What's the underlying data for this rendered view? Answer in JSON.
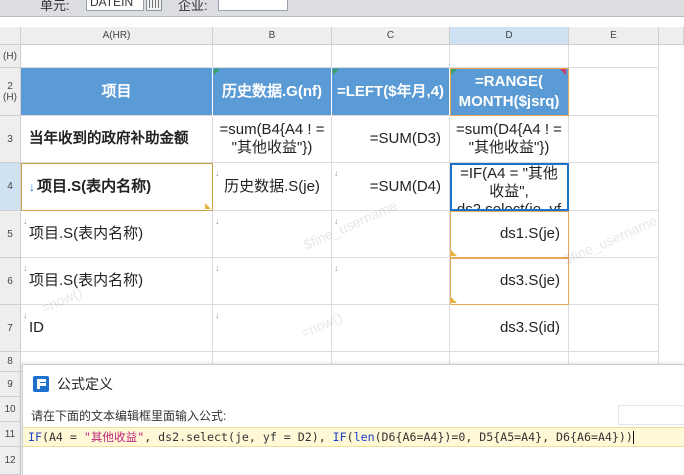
{
  "toolbar": {
    "label1": "单元:",
    "field1_value": "DATEIN",
    "label2": "企业:",
    "field2_value": ""
  },
  "grid": {
    "corner": "",
    "columns": [
      {
        "id": "A",
        "label": "A(HR)"
      },
      {
        "id": "B",
        "label": "B"
      },
      {
        "id": "C",
        "label": "C"
      },
      {
        "id": "D",
        "label": "D"
      },
      {
        "id": "E",
        "label": "E"
      }
    ],
    "rows": [
      {
        "label": "(H)"
      },
      {
        "label": "2 (H)"
      },
      {
        "label": "3"
      },
      {
        "label": "4"
      },
      {
        "label": "5"
      },
      {
        "label": "6"
      },
      {
        "label": "7"
      },
      {
        "label": "8"
      },
      {
        "label": "9"
      },
      {
        "label": "10"
      },
      {
        "label": "11"
      },
      {
        "label": "12"
      }
    ],
    "header_row": {
      "a": "项目",
      "b": "历史数据.G(nf)",
      "c": "=LEFT($年月,4)",
      "d": "=RANGE( MONTH($jsrq)"
    },
    "row3": {
      "a": "当年收到的政府补助金额",
      "b": "=sum(B4{A4 ! = \"其他收益\"})",
      "c": "=SUM(D3)",
      "d": "=sum(D4{A4 ! = \"其他收益\"})"
    },
    "row4": {
      "a": "项目.S(表内名称)",
      "b": "历史数据.S(je)",
      "c": "=SUM(D4)",
      "d": "=IF(A4 = \"其他收益\", ds2.select(je, yf"
    },
    "row5": {
      "a": "项目.S(表内名称)",
      "d": "ds1.S(je)"
    },
    "row6": {
      "a": "项目.S(表内名称)",
      "d": "ds3.S(je)"
    },
    "row7": {
      "a": "ID",
      "d": "ds3.S(id)"
    },
    "watermarks": [
      "$fine_username",
      "=now()",
      "$fine_username",
      "=now()"
    ]
  },
  "dialog": {
    "title": "公式定义",
    "prompt": "请在下面的文本编辑框里面输入公式:",
    "formula_tokens": [
      {
        "t": "IF",
        "k": "kw"
      },
      {
        "t": "(A4 = ",
        "k": "txt"
      },
      {
        "t": "\"其他收益\"",
        "k": "str"
      },
      {
        "t": ", ds2.select(je, yf = D2), ",
        "k": "txt"
      },
      {
        "t": "IF",
        "k": "kw"
      },
      {
        "t": "(",
        "k": "txt"
      },
      {
        "t": "len",
        "k": "kw"
      },
      {
        "t": "(D6{A6=A4})=0, D5{A5=A4}, D6{A6=A4}))",
        "k": "txt"
      }
    ]
  },
  "colors": {
    "header_blue": "#5b9bd5",
    "selection_blue": "#1a73c9",
    "editor_bg": "#fff9d8",
    "keyword": "#1d3fc4",
    "string": "#c0247a"
  }
}
